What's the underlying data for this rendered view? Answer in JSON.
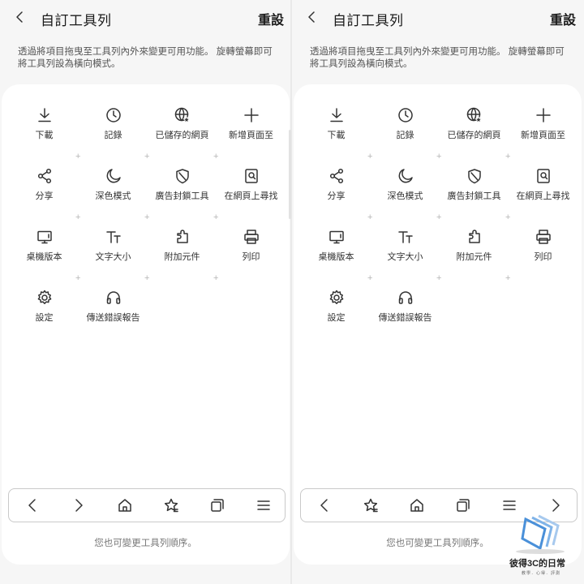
{
  "header": {
    "title": "自訂工具列",
    "reset_label": "重設"
  },
  "description": "透過將項目拖曳至工具列內外來變更可用功能。 旋轉螢幕即可將工具列設為橫向模式。",
  "tools": [
    {
      "label": "下載",
      "icon": "download-icon"
    },
    {
      "label": "記錄",
      "icon": "history-clock-icon"
    },
    {
      "label": "已儲存的網頁",
      "icon": "saved-pages-globe-icon"
    },
    {
      "label": "新增頁面至",
      "icon": "plus-icon"
    },
    {
      "label": "分享",
      "icon": "share-icon"
    },
    {
      "label": "深色模式",
      "icon": "moon-icon"
    },
    {
      "label": "廣告封鎖工具",
      "icon": "shield-icon"
    },
    {
      "label": "在網頁上尋找",
      "icon": "find-in-page-icon"
    },
    {
      "label": "桌機版本",
      "icon": "desktop-icon"
    },
    {
      "label": "文字大小",
      "icon": "text-size-icon"
    },
    {
      "label": "附加元件",
      "icon": "add-ons-puzzle-icon"
    },
    {
      "label": "列印",
      "icon": "print-icon"
    },
    {
      "label": "設定",
      "icon": "settings-gear-icon"
    },
    {
      "label": "傳送錯誤報告",
      "icon": "headset-icon"
    }
  ],
  "bottom_bar_left": [
    "back-icon",
    "forward-icon",
    "home-icon",
    "bookmarks-icon",
    "tabs-icon",
    "menu-icon"
  ],
  "bottom_bar_right": [
    "back-icon",
    "bookmarks-icon",
    "home-icon",
    "tabs-icon",
    "menu-icon",
    "forward-icon"
  ],
  "hint": "您也可變更工具列順序。",
  "watermark": {
    "title": "彼得3C的日常",
    "subtitle": "教學．心得．評測"
  },
  "colors": {
    "background": "#f6f6f6",
    "card": "#ffffff",
    "text": "#222222",
    "plus": "#b5b5b5",
    "watermark_blue": "#4a90d9"
  }
}
